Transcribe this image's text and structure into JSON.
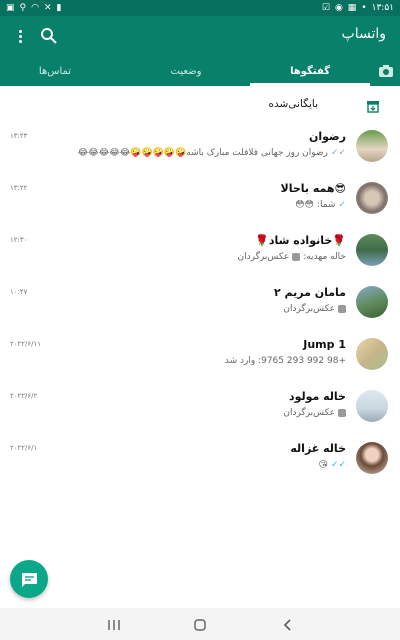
{
  "status_bar": {
    "time": "۱۳:۵۱"
  },
  "app_bar": {
    "title": "واتساپ",
    "menu_icon": "more-vertical-icon",
    "search_icon": "search-icon"
  },
  "tabs": {
    "chats": "گفتگوها",
    "status": "وضعیت",
    "contacts": "تماس‌ها",
    "camera_icon": "camera-icon"
  },
  "archived": {
    "label": "بایگانی‌شده",
    "icon": "archive-icon"
  },
  "chats": [
    {
      "name": "رضوان",
      "time": "۱۳:۲۳",
      "preview": "رضوان روز جهانی فلافلت مبارک باشه🤪🤪🤪🤪🤪😂😂😂😂😂",
      "tick": "✓✓",
      "tick_color": "#7aa7d6"
    },
    {
      "name": "همه باحالا😎",
      "time": "۱۳:۲۲",
      "preview_prefix": "شما:",
      "preview": "😳😳",
      "tick": "✓",
      "tick_color": "#7aa7d6"
    },
    {
      "name": "🌹خانواده شاد🌹",
      "time": "۱۲:۳۰",
      "preview_prefix": "خاله مهدیه:",
      "preview": "عکس‌برگردان"
    },
    {
      "name": "مامان مریم ۲",
      "time": "۱۰:۴۷",
      "preview": "عکس‌برگردان"
    },
    {
      "name": "Jump 1",
      "time": "۲۰۲۲/۶/۱۱",
      "preview": "+98 992 293 9765: وارد شد"
    },
    {
      "name": "خاله مولود",
      "time": "۲۰۲۲/۶/۲",
      "preview": "عکس‌برگردان"
    },
    {
      "name": "خاله غزاله",
      "time": "۲۰۲۲/۶/۱",
      "preview": "😘",
      "tick": "✓✓",
      "tick_color": "#34b7f1"
    }
  ],
  "colors": {
    "primary": "#08806a",
    "status_bar": "#08705e",
    "fab": "#0aa889",
    "nav_bar": "#f4f4f4"
  }
}
